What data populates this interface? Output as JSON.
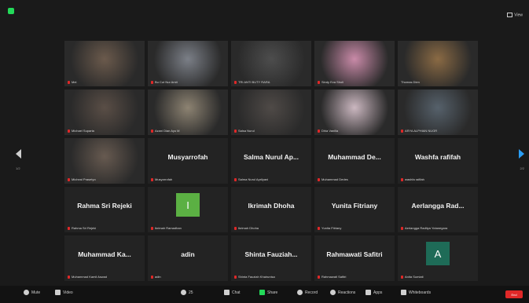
{
  "topbar": {
    "view_label": "View"
  },
  "participants": [
    {
      "display": "video",
      "label": "Mei",
      "mic_muted": true,
      "bg": "#6b5a4c",
      "active": false
    },
    {
      "display": "video",
      "label": "Bu Cut Nur Amit",
      "mic_muted": true,
      "bg": "#7b7f87",
      "active": false
    },
    {
      "display": "video",
      "label": "TRI ANTI BUTY RARA",
      "mic_muted": true,
      "bg": "#4d4d4d",
      "active": false
    },
    {
      "display": "video",
      "label": "Sindy Eva Sholi",
      "mic_muted": true,
      "bg": "#c98aa8",
      "active": false
    },
    {
      "display": "video",
      "label": "Thomas Dien",
      "mic_muted": false,
      "bg": "#8a6a44",
      "active": true
    },
    {
      "display": "video",
      "label": "Michael Suparta",
      "mic_muted": true,
      "bg": "#5a4e46",
      "active": false
    },
    {
      "display": "video",
      "label": "Azani Dian Ayu M",
      "mic_muted": true,
      "bg": "#8d8372",
      "active": false
    },
    {
      "display": "video",
      "label": "Salsa Nurul",
      "mic_muted": true,
      "bg": "#4f4a47",
      "active": false
    },
    {
      "display": "video",
      "label": "Dhia Vanilla",
      "mic_muted": true,
      "bg": "#cbb7c0",
      "active": false
    },
    {
      "display": "video",
      "label": "ARYA ALPHIAN NUGR",
      "mic_muted": true,
      "bg": "#56616b",
      "active": false
    },
    {
      "display": "video",
      "label": "Micheal Prasetyo",
      "mic_muted": true,
      "bg": "#675a50",
      "active": false
    },
    {
      "display": "name",
      "name": "Musyarrofah",
      "label": "Musyarrofah",
      "mic_muted": true,
      "active": false
    },
    {
      "display": "name",
      "name": "Salma Nurul Ap...",
      "label": "Salma Nurul Aprilyani",
      "mic_muted": true,
      "active": false
    },
    {
      "display": "name",
      "name": "Muhammad De...",
      "label": "Muhammad Dedes",
      "mic_muted": true,
      "active": false
    },
    {
      "display": "name",
      "name": "Washfa rafifah",
      "label": "washfa rafifah",
      "mic_muted": true,
      "active": false
    },
    {
      "display": "name",
      "name": "Rahma Sri Rejeki",
      "label": "Rahma Sri Rejeki",
      "mic_muted": true,
      "active": false
    },
    {
      "display": "letter",
      "letter": "I",
      "letter_bg": "#5bb043",
      "label": "Ikrimah Ramadhan",
      "mic_muted": true,
      "active": false
    },
    {
      "display": "name",
      "name": "Ikrimah Dhoha",
      "label": "Ikrimah Dhoha",
      "mic_muted": true,
      "active": false
    },
    {
      "display": "name",
      "name": "Yunita Fitriany",
      "label": "Yunita Fitriany",
      "mic_muted": true,
      "active": false
    },
    {
      "display": "name",
      "name": "Aerlangga Rad...",
      "label": "Aerlangga Raditya Yotanegara",
      "mic_muted": true,
      "active": false
    },
    {
      "display": "name",
      "name": "Muhammad Ka...",
      "label": "Muhammad Kamil Aswad",
      "mic_muted": true,
      "active": false
    },
    {
      "display": "name",
      "name": "adin",
      "label": "adin",
      "mic_muted": true,
      "active": false
    },
    {
      "display": "name",
      "name": "Shinta Fauziah...",
      "label": "Shinta Fauziah Khairunisa",
      "mic_muted": true,
      "active": false
    },
    {
      "display": "name",
      "name": "Rahmawati Safitri",
      "label": "Rahmawati Safitri",
      "mic_muted": true,
      "active": false
    },
    {
      "display": "letter",
      "letter": "A",
      "letter_bg": "#1e6b57",
      "label": "Anita Sumiati",
      "mic_muted": true,
      "active": false
    }
  ],
  "pagination": {
    "left_page": "1/2",
    "right_page": "2/2"
  },
  "toolbar": {
    "mute_label": "Mute",
    "video_label": "Video",
    "participants_label": "Participants",
    "participants_count": "25",
    "chat_label": "Chat",
    "share_label": "Share",
    "record_label": "Record",
    "reactions_label": "Reactions",
    "apps_label": "Apps",
    "whiteboards_label": "Whiteboards",
    "end_label": "End"
  },
  "colors": {
    "accent": "#23d959",
    "end": "#e02828",
    "active_border": "#e6d92a",
    "arrow": "#2a9df4"
  }
}
